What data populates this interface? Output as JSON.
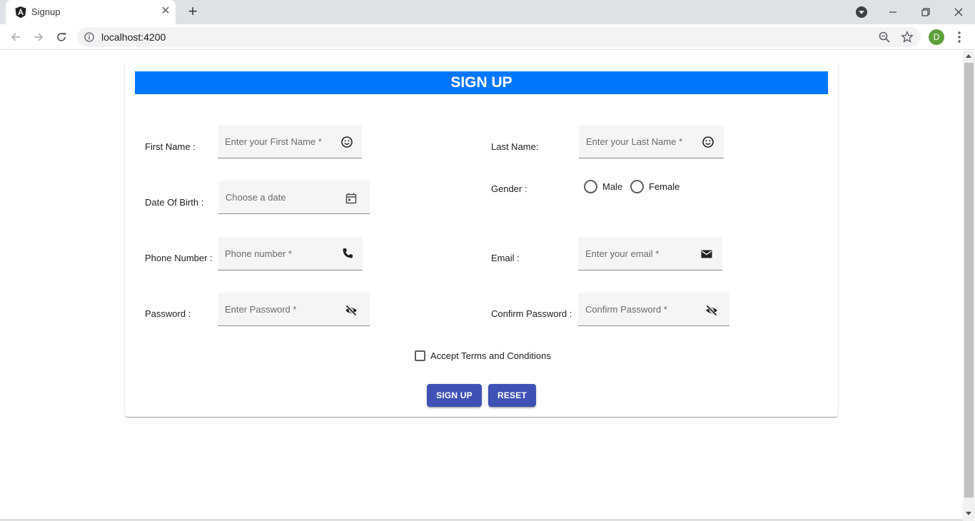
{
  "browser": {
    "tab_title": "Signup",
    "tab_close": "✕",
    "new_tab": "+",
    "url": "localhost:4200",
    "profile_initial": "D"
  },
  "form": {
    "title": "SIGN UP",
    "first_name": {
      "label": "First Name :",
      "placeholder": "Enter your First Name *",
      "icon": "face-icon"
    },
    "last_name": {
      "label": "Last Name:",
      "placeholder": "Enter your Last Name *",
      "icon": "face-icon"
    },
    "dob": {
      "label": "Date Of Birth :",
      "placeholder": "Choose a date",
      "icon": "calendar-icon"
    },
    "gender": {
      "label": "Gender :",
      "options": [
        "Male",
        "Female"
      ]
    },
    "phone": {
      "label": "Phone Number :",
      "placeholder": "Phone number *",
      "icon": "phone-icon"
    },
    "email": {
      "label": "Email :",
      "placeholder": "Enter your email *",
      "icon": "mail-icon"
    },
    "password": {
      "label": "Password :",
      "placeholder": "Enter Password *",
      "icon": "visibility-off-icon"
    },
    "confirm_password": {
      "label": "Confirm Password :",
      "placeholder": "Confirm Password *",
      "icon": "visibility-off-icon"
    },
    "terms_label": "Accept Terms and Conditions",
    "submit_label": "SIGN UP",
    "reset_label": "RESET"
  },
  "colors": {
    "header": "#0077ff",
    "button": "#3f51b5"
  }
}
